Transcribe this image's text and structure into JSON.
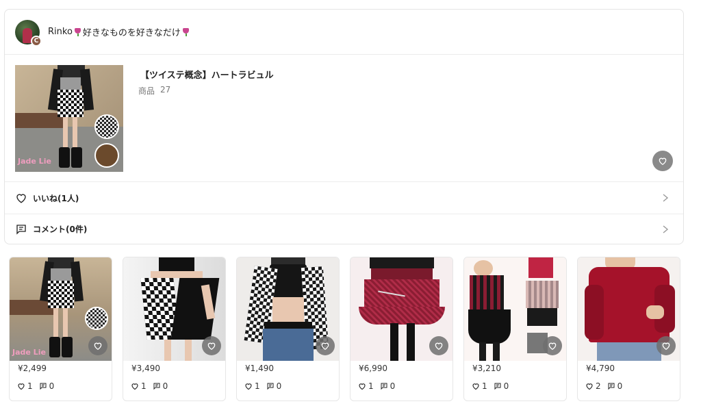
{
  "user": {
    "avatar_badge": "C",
    "name": "Rinko",
    "bio": "好きなものを好きなだけ"
  },
  "collection": {
    "title": "【ツイステ概念】ハートラビュル",
    "items_label": "商品",
    "items_count": "27",
    "cover_watermark": "Jade Lie"
  },
  "actions": {
    "likes_label": "いいね(1人)",
    "comments_label": "コメント(0件)"
  },
  "products": [
    {
      "price": "¥2,499",
      "likes": "1",
      "comments": "0",
      "watermark": "Jade Lie",
      "overlay": []
    },
    {
      "price": "¥3,490",
      "likes": "1",
      "comments": "0",
      "watermark": "",
      "overlay": []
    },
    {
      "price": "¥1,490",
      "likes": "1",
      "comments": "0",
      "watermark": "",
      "overlay": []
    },
    {
      "price": "¥6,990",
      "likes": "1",
      "comments": "0",
      "watermark": "",
      "overlay": []
    },
    {
      "price": "¥3,210",
      "likes": "1",
      "comments": "0",
      "watermark": "",
      "overlay": []
    },
    {
      "price": "¥4,790",
      "likes": "2",
      "comments": "0",
      "watermark": "",
      "overlay": []
    }
  ],
  "colors": {
    "accent_tulip": "#c9468f",
    "fav_bg": "#8a8a8a",
    "border": "#e4e4e4"
  },
  "icons": {
    "heart": "heart-outline-icon",
    "comment": "comment-icon",
    "chevron": "chevron-right-icon"
  }
}
